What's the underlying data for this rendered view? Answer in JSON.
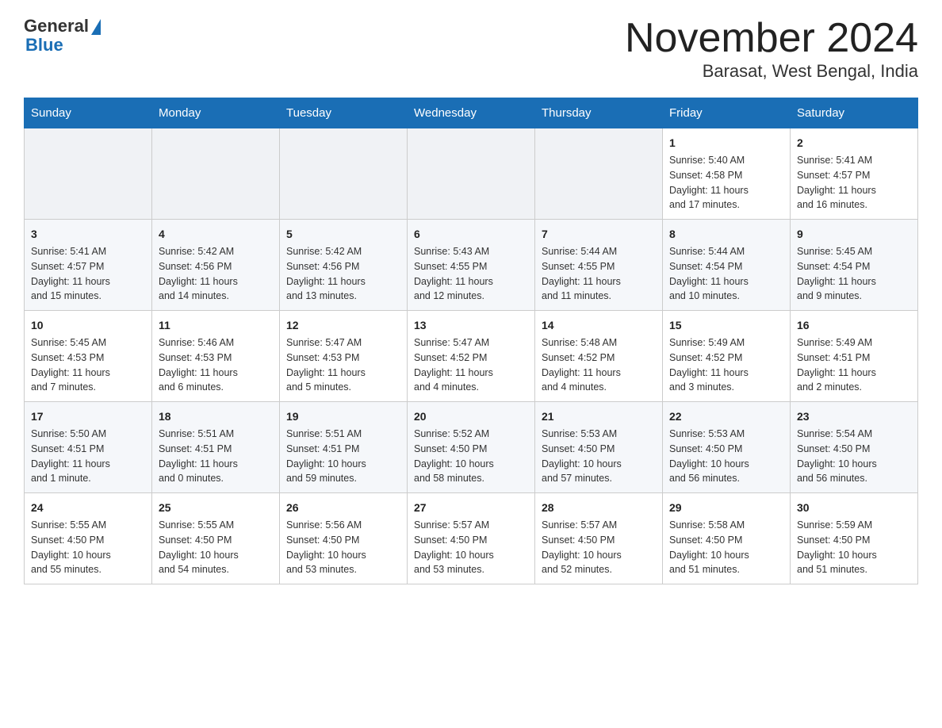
{
  "header": {
    "logo_general": "General",
    "logo_blue": "Blue",
    "month_title": "November 2024",
    "location": "Barasat, West Bengal, India"
  },
  "days_of_week": [
    "Sunday",
    "Monday",
    "Tuesday",
    "Wednesday",
    "Thursday",
    "Friday",
    "Saturday"
  ],
  "weeks": [
    [
      {
        "day": "",
        "info": ""
      },
      {
        "day": "",
        "info": ""
      },
      {
        "day": "",
        "info": ""
      },
      {
        "day": "",
        "info": ""
      },
      {
        "day": "",
        "info": ""
      },
      {
        "day": "1",
        "info": "Sunrise: 5:40 AM\nSunset: 4:58 PM\nDaylight: 11 hours\nand 17 minutes."
      },
      {
        "day": "2",
        "info": "Sunrise: 5:41 AM\nSunset: 4:57 PM\nDaylight: 11 hours\nand 16 minutes."
      }
    ],
    [
      {
        "day": "3",
        "info": "Sunrise: 5:41 AM\nSunset: 4:57 PM\nDaylight: 11 hours\nand 15 minutes."
      },
      {
        "day": "4",
        "info": "Sunrise: 5:42 AM\nSunset: 4:56 PM\nDaylight: 11 hours\nand 14 minutes."
      },
      {
        "day": "5",
        "info": "Sunrise: 5:42 AM\nSunset: 4:56 PM\nDaylight: 11 hours\nand 13 minutes."
      },
      {
        "day": "6",
        "info": "Sunrise: 5:43 AM\nSunset: 4:55 PM\nDaylight: 11 hours\nand 12 minutes."
      },
      {
        "day": "7",
        "info": "Sunrise: 5:44 AM\nSunset: 4:55 PM\nDaylight: 11 hours\nand 11 minutes."
      },
      {
        "day": "8",
        "info": "Sunrise: 5:44 AM\nSunset: 4:54 PM\nDaylight: 11 hours\nand 10 minutes."
      },
      {
        "day": "9",
        "info": "Sunrise: 5:45 AM\nSunset: 4:54 PM\nDaylight: 11 hours\nand 9 minutes."
      }
    ],
    [
      {
        "day": "10",
        "info": "Sunrise: 5:45 AM\nSunset: 4:53 PM\nDaylight: 11 hours\nand 7 minutes."
      },
      {
        "day": "11",
        "info": "Sunrise: 5:46 AM\nSunset: 4:53 PM\nDaylight: 11 hours\nand 6 minutes."
      },
      {
        "day": "12",
        "info": "Sunrise: 5:47 AM\nSunset: 4:53 PM\nDaylight: 11 hours\nand 5 minutes."
      },
      {
        "day": "13",
        "info": "Sunrise: 5:47 AM\nSunset: 4:52 PM\nDaylight: 11 hours\nand 4 minutes."
      },
      {
        "day": "14",
        "info": "Sunrise: 5:48 AM\nSunset: 4:52 PM\nDaylight: 11 hours\nand 4 minutes."
      },
      {
        "day": "15",
        "info": "Sunrise: 5:49 AM\nSunset: 4:52 PM\nDaylight: 11 hours\nand 3 minutes."
      },
      {
        "day": "16",
        "info": "Sunrise: 5:49 AM\nSunset: 4:51 PM\nDaylight: 11 hours\nand 2 minutes."
      }
    ],
    [
      {
        "day": "17",
        "info": "Sunrise: 5:50 AM\nSunset: 4:51 PM\nDaylight: 11 hours\nand 1 minute."
      },
      {
        "day": "18",
        "info": "Sunrise: 5:51 AM\nSunset: 4:51 PM\nDaylight: 11 hours\nand 0 minutes."
      },
      {
        "day": "19",
        "info": "Sunrise: 5:51 AM\nSunset: 4:51 PM\nDaylight: 10 hours\nand 59 minutes."
      },
      {
        "day": "20",
        "info": "Sunrise: 5:52 AM\nSunset: 4:50 PM\nDaylight: 10 hours\nand 58 minutes."
      },
      {
        "day": "21",
        "info": "Sunrise: 5:53 AM\nSunset: 4:50 PM\nDaylight: 10 hours\nand 57 minutes."
      },
      {
        "day": "22",
        "info": "Sunrise: 5:53 AM\nSunset: 4:50 PM\nDaylight: 10 hours\nand 56 minutes."
      },
      {
        "day": "23",
        "info": "Sunrise: 5:54 AM\nSunset: 4:50 PM\nDaylight: 10 hours\nand 56 minutes."
      }
    ],
    [
      {
        "day": "24",
        "info": "Sunrise: 5:55 AM\nSunset: 4:50 PM\nDaylight: 10 hours\nand 55 minutes."
      },
      {
        "day": "25",
        "info": "Sunrise: 5:55 AM\nSunset: 4:50 PM\nDaylight: 10 hours\nand 54 minutes."
      },
      {
        "day": "26",
        "info": "Sunrise: 5:56 AM\nSunset: 4:50 PM\nDaylight: 10 hours\nand 53 minutes."
      },
      {
        "day": "27",
        "info": "Sunrise: 5:57 AM\nSunset: 4:50 PM\nDaylight: 10 hours\nand 53 minutes."
      },
      {
        "day": "28",
        "info": "Sunrise: 5:57 AM\nSunset: 4:50 PM\nDaylight: 10 hours\nand 52 minutes."
      },
      {
        "day": "29",
        "info": "Sunrise: 5:58 AM\nSunset: 4:50 PM\nDaylight: 10 hours\nand 51 minutes."
      },
      {
        "day": "30",
        "info": "Sunrise: 5:59 AM\nSunset: 4:50 PM\nDaylight: 10 hours\nand 51 minutes."
      }
    ]
  ]
}
